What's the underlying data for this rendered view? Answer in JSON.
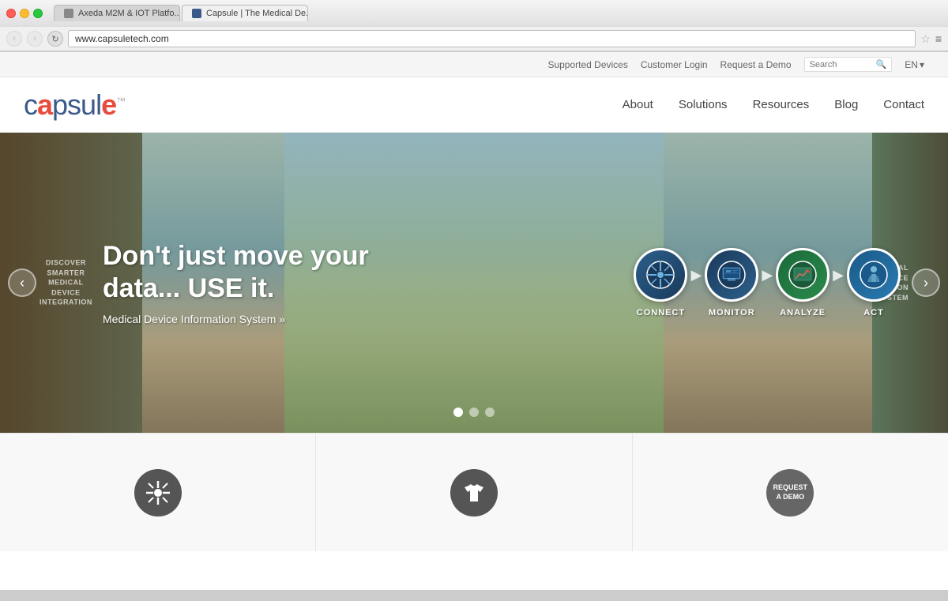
{
  "browser": {
    "tabs": [
      {
        "label": "Axeda M2M & IOT Platfo...",
        "active": false,
        "favicon": "A"
      },
      {
        "label": "Capsule | The Medical De...",
        "active": true,
        "favicon": "C"
      }
    ],
    "url": "www.capsuletech.com"
  },
  "utility_bar": {
    "supported_devices": "Supported Devices",
    "customer_login": "Customer Login",
    "request_demo": "Request a Demo",
    "search_placeholder": "Search",
    "language": "EN"
  },
  "nav": {
    "logo_text": "capsule",
    "logo_tm": "™",
    "links": [
      {
        "label": "About"
      },
      {
        "label": "Solutions"
      },
      {
        "label": "Resources"
      },
      {
        "label": "Blog"
      },
      {
        "label": "Contact"
      }
    ]
  },
  "hero": {
    "title": "Don't just move your\ndata... USE it.",
    "subtitle": "Medical Device Information System »",
    "process_steps": [
      {
        "label": "CONNECT",
        "icon": "⚙"
      },
      {
        "label": "MONITOR",
        "icon": "📊"
      },
      {
        "label": "ANALYZE",
        "icon": "📈"
      },
      {
        "label": "ACT",
        "icon": "👔"
      }
    ],
    "carousel_side_left": "DISCOVER\nSMARTER\nMEDICAL\nDEVICE\nINTEGRATION",
    "carousel_side_right": "MEDICAL\nDEVICE\nINFORMATION\nSYSTEM",
    "dots": [
      {
        "active": true
      },
      {
        "active": false
      },
      {
        "active": false
      }
    ]
  },
  "bottom_section": {
    "cols": [
      {
        "icon": "connect",
        "label": ""
      },
      {
        "icon": "shirt",
        "label": ""
      },
      {
        "icon": "request-demo",
        "label": "REQUEST\nA DEMO"
      }
    ]
  }
}
